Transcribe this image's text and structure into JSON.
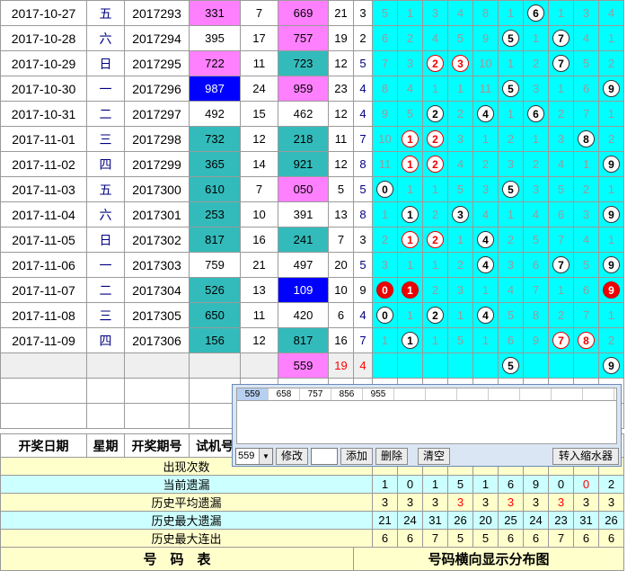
{
  "rows": [
    {
      "date": "2017-10-27",
      "week": "五",
      "period": "2017293",
      "test": "331",
      "test_class": "pink",
      "v1": "7",
      "draw": "669",
      "draw_class": "pink",
      "sum": "21",
      "span": "3",
      "span_class": "",
      "dist": [
        {
          "t": "n",
          "v": "5"
        },
        {
          "t": "n",
          "v": "1"
        },
        {
          "t": "n",
          "v": "3"
        },
        {
          "t": "n",
          "v": "4"
        },
        {
          "t": "n",
          "v": "8"
        },
        {
          "t": "n",
          "v": "1"
        },
        {
          "t": "w",
          "v": "6"
        },
        {
          "t": "n",
          "v": "1"
        },
        {
          "t": "n",
          "v": "3"
        },
        {
          "t": "n",
          "v": "4"
        }
      ]
    },
    {
      "date": "2017-10-28",
      "week": "六",
      "period": "2017294",
      "test": "395",
      "test_class": "",
      "v1": "17",
      "draw": "757",
      "draw_class": "pink",
      "sum": "19",
      "span": "2",
      "span_class": "",
      "dist": [
        {
          "t": "n",
          "v": "6"
        },
        {
          "t": "n",
          "v": "2"
        },
        {
          "t": "n",
          "v": "4"
        },
        {
          "t": "n",
          "v": "5"
        },
        {
          "t": "n",
          "v": "9"
        },
        {
          "t": "w",
          "v": "5"
        },
        {
          "t": "n",
          "v": "1"
        },
        {
          "t": "w",
          "v": "7"
        },
        {
          "t": "n",
          "v": "4"
        },
        {
          "t": "n",
          "v": "1"
        }
      ]
    },
    {
      "date": "2017-10-29",
      "week": "日",
      "period": "2017295",
      "test": "722",
      "test_class": "pink",
      "v1": "11",
      "draw": "723",
      "draw_class": "teal",
      "sum": "12",
      "span": "5",
      "span_class": "bl",
      "dist": [
        {
          "t": "n",
          "v": "7"
        },
        {
          "t": "n",
          "v": "3"
        },
        {
          "t": "r",
          "v": "2"
        },
        {
          "t": "r",
          "v": "3"
        },
        {
          "t": "n",
          "v": "10"
        },
        {
          "t": "n",
          "v": "1"
        },
        {
          "t": "n",
          "v": "2"
        },
        {
          "t": "w",
          "v": "7"
        },
        {
          "t": "n",
          "v": "5"
        },
        {
          "t": "n",
          "v": "2"
        }
      ]
    },
    {
      "date": "2017-10-30",
      "week": "一",
      "period": "2017296",
      "test": "987",
      "test_class": "blue",
      "v1": "24",
      "draw": "959",
      "draw_class": "pink",
      "sum": "23",
      "span": "4",
      "span_class": "bl",
      "dist": [
        {
          "t": "n",
          "v": "8"
        },
        {
          "t": "n",
          "v": "4"
        },
        {
          "t": "n",
          "v": "1"
        },
        {
          "t": "n",
          "v": "1"
        },
        {
          "t": "n",
          "v": "11"
        },
        {
          "t": "w",
          "v": "5"
        },
        {
          "t": "n",
          "v": "3"
        },
        {
          "t": "n",
          "v": "1"
        },
        {
          "t": "n",
          "v": "6"
        },
        {
          "t": "w",
          "v": "9"
        }
      ]
    },
    {
      "date": "2017-10-31",
      "week": "二",
      "period": "2017297",
      "test": "492",
      "test_class": "",
      "v1": "15",
      "draw": "462",
      "draw_class": "",
      "sum": "12",
      "span": "4",
      "span_class": "bl",
      "dist": [
        {
          "t": "n",
          "v": "9"
        },
        {
          "t": "n",
          "v": "5"
        },
        {
          "t": "w",
          "v": "2"
        },
        {
          "t": "n",
          "v": "2"
        },
        {
          "t": "w",
          "v": "4"
        },
        {
          "t": "n",
          "v": "1"
        },
        {
          "t": "w",
          "v": "6"
        },
        {
          "t": "n",
          "v": "2"
        },
        {
          "t": "n",
          "v": "7"
        },
        {
          "t": "n",
          "v": "1"
        }
      ]
    },
    {
      "date": "2017-11-01",
      "week": "三",
      "period": "2017298",
      "test": "732",
      "test_class": "teal",
      "v1": "12",
      "draw": "218",
      "draw_class": "teal",
      "sum": "11",
      "span": "7",
      "span_class": "bl",
      "dist": [
        {
          "t": "n",
          "v": "10"
        },
        {
          "t": "r",
          "v": "1"
        },
        {
          "t": "r",
          "v": "2"
        },
        {
          "t": "n",
          "v": "3"
        },
        {
          "t": "n",
          "v": "1"
        },
        {
          "t": "n",
          "v": "2"
        },
        {
          "t": "n",
          "v": "1"
        },
        {
          "t": "n",
          "v": "3"
        },
        {
          "t": "w",
          "v": "8"
        },
        {
          "t": "n",
          "v": "2"
        }
      ]
    },
    {
      "date": "2017-11-02",
      "week": "四",
      "period": "2017299",
      "test": "365",
      "test_class": "teal",
      "v1": "14",
      "draw": "921",
      "draw_class": "teal",
      "sum": "12",
      "span": "8",
      "span_class": "bl",
      "dist": [
        {
          "t": "n",
          "v": "11"
        },
        {
          "t": "r",
          "v": "1"
        },
        {
          "t": "r",
          "v": "2"
        },
        {
          "t": "n",
          "v": "4"
        },
        {
          "t": "n",
          "v": "2"
        },
        {
          "t": "n",
          "v": "3"
        },
        {
          "t": "n",
          "v": "2"
        },
        {
          "t": "n",
          "v": "4"
        },
        {
          "t": "n",
          "v": "1"
        },
        {
          "t": "w",
          "v": "9"
        }
      ]
    },
    {
      "date": "2017-11-03",
      "week": "五",
      "period": "2017300",
      "test": "610",
      "test_class": "teal",
      "v1": "7",
      "draw": "050",
      "draw_class": "pink",
      "sum": "5",
      "span": "5",
      "span_class": "bl",
      "dist": [
        {
          "t": "w",
          "v": "0"
        },
        {
          "t": "n",
          "v": "1"
        },
        {
          "t": "n",
          "v": "1"
        },
        {
          "t": "n",
          "v": "5"
        },
        {
          "t": "n",
          "v": "3"
        },
        {
          "t": "w",
          "v": "5"
        },
        {
          "t": "n",
          "v": "3"
        },
        {
          "t": "n",
          "v": "5"
        },
        {
          "t": "n",
          "v": "2"
        },
        {
          "t": "n",
          "v": "1"
        }
      ]
    },
    {
      "date": "2017-11-04",
      "week": "六",
      "period": "2017301",
      "test": "253",
      "test_class": "teal",
      "v1": "10",
      "draw": "391",
      "draw_class": "",
      "sum": "13",
      "span": "8",
      "span_class": "bl",
      "dist": [
        {
          "t": "n",
          "v": "1"
        },
        {
          "t": "w",
          "v": "1"
        },
        {
          "t": "n",
          "v": "2"
        },
        {
          "t": "w",
          "v": "3"
        },
        {
          "t": "n",
          "v": "4"
        },
        {
          "t": "n",
          "v": "1"
        },
        {
          "t": "n",
          "v": "4"
        },
        {
          "t": "n",
          "v": "6"
        },
        {
          "t": "n",
          "v": "3"
        },
        {
          "t": "w",
          "v": "9"
        }
      ]
    },
    {
      "date": "2017-11-05",
      "week": "日",
      "period": "2017302",
      "test": "817",
      "test_class": "teal",
      "v1": "16",
      "draw": "241",
      "draw_class": "teal",
      "sum": "7",
      "span": "3",
      "span_class": "",
      "dist": [
        {
          "t": "n",
          "v": "2"
        },
        {
          "t": "r",
          "v": "1"
        },
        {
          "t": "r",
          "v": "2"
        },
        {
          "t": "n",
          "v": "1"
        },
        {
          "t": "w",
          "v": "4"
        },
        {
          "t": "n",
          "v": "2"
        },
        {
          "t": "n",
          "v": "5"
        },
        {
          "t": "n",
          "v": "7"
        },
        {
          "t": "n",
          "v": "4"
        },
        {
          "t": "n",
          "v": "1"
        }
      ]
    },
    {
      "date": "2017-11-06",
      "week": "一",
      "period": "2017303",
      "test": "759",
      "test_class": "",
      "v1": "21",
      "draw": "497",
      "draw_class": "",
      "sum": "20",
      "span": "5",
      "span_class": "bl",
      "dist": [
        {
          "t": "n",
          "v": "3"
        },
        {
          "t": "n",
          "v": "1"
        },
        {
          "t": "n",
          "v": "1"
        },
        {
          "t": "n",
          "v": "2"
        },
        {
          "t": "w",
          "v": "4"
        },
        {
          "t": "n",
          "v": "3"
        },
        {
          "t": "n",
          "v": "6"
        },
        {
          "t": "w",
          "v": "7"
        },
        {
          "t": "n",
          "v": "5"
        },
        {
          "t": "w",
          "v": "9"
        }
      ]
    },
    {
      "date": "2017-11-07",
      "week": "二",
      "period": "2017304",
      "test": "526",
      "test_class": "teal",
      "v1": "13",
      "draw": "109",
      "draw_class": "blue",
      "sum": "10",
      "span": "9",
      "span_class": "",
      "dist": [
        {
          "t": "f",
          "v": "0"
        },
        {
          "t": "f",
          "v": "1"
        },
        {
          "t": "n",
          "v": "2"
        },
        {
          "t": "n",
          "v": "3"
        },
        {
          "t": "n",
          "v": "1"
        },
        {
          "t": "n",
          "v": "4"
        },
        {
          "t": "n",
          "v": "7"
        },
        {
          "t": "n",
          "v": "1"
        },
        {
          "t": "n",
          "v": "6"
        },
        {
          "t": "f",
          "v": "9"
        }
      ]
    },
    {
      "date": "2017-11-08",
      "week": "三",
      "period": "2017305",
      "test": "650",
      "test_class": "teal",
      "v1": "11",
      "draw": "420",
      "draw_class": "",
      "sum": "6",
      "span": "4",
      "span_class": "bl",
      "dist": [
        {
          "t": "w",
          "v": "0"
        },
        {
          "t": "n",
          "v": "1"
        },
        {
          "t": "w",
          "v": "2"
        },
        {
          "t": "n",
          "v": "1"
        },
        {
          "t": "w",
          "v": "4"
        },
        {
          "t": "n",
          "v": "5"
        },
        {
          "t": "n",
          "v": "8"
        },
        {
          "t": "n",
          "v": "2"
        },
        {
          "t": "n",
          "v": "7"
        },
        {
          "t": "n",
          "v": "1"
        }
      ]
    },
    {
      "date": "2017-11-09",
      "week": "四",
      "period": "2017306",
      "test": "156",
      "test_class": "teal",
      "v1": "12",
      "draw": "817",
      "draw_class": "teal",
      "sum": "16",
      "span": "7",
      "span_class": "bl",
      "dist": [
        {
          "t": "n",
          "v": "1"
        },
        {
          "t": "w",
          "v": "1"
        },
        {
          "t": "n",
          "v": "1"
        },
        {
          "t": "n",
          "v": "5"
        },
        {
          "t": "n",
          "v": "1"
        },
        {
          "t": "n",
          "v": "6"
        },
        {
          "t": "n",
          "v": "9"
        },
        {
          "t": "r",
          "v": "7"
        },
        {
          "t": "r",
          "v": "8"
        },
        {
          "t": "n",
          "v": "2"
        }
      ]
    }
  ],
  "pending": {
    "draw": "559",
    "sum": "19",
    "span": "4",
    "dist": [
      {
        "t": "e",
        "v": ""
      },
      {
        "t": "e",
        "v": ""
      },
      {
        "t": "e",
        "v": ""
      },
      {
        "t": "e",
        "v": ""
      },
      {
        "t": "e",
        "v": ""
      },
      {
        "t": "w",
        "v": "5"
      },
      {
        "t": "e",
        "v": ""
      },
      {
        "t": "e",
        "v": ""
      },
      {
        "t": "e",
        "v": ""
      },
      {
        "t": "w",
        "v": "9"
      }
    ]
  },
  "header": {
    "date": "开奖日期",
    "week": "星期",
    "period": "开奖期号",
    "test": "试机号"
  },
  "stats": [
    {
      "label": "出现次数",
      "class": "y",
      "values": [
        "",
        "",
        "",
        "",
        "",
        "",
        "",
        "",
        "",
        ""
      ]
    },
    {
      "label": "当前遗漏",
      "class": "c",
      "values": [
        "1",
        "0",
        "1",
        "5",
        "1",
        "6",
        "9",
        "0",
        "0",
        "2"
      ],
      "red": [
        8
      ]
    },
    {
      "label": "历史平均遗漏",
      "class": "y",
      "values": [
        "3",
        "3",
        "3",
        "3",
        "3",
        "3",
        "3",
        "3",
        "3",
        "3"
      ],
      "red": [
        3,
        5,
        7
      ]
    },
    {
      "label": "历史最大遗漏",
      "class": "c",
      "values": [
        "21",
        "24",
        "31",
        "26",
        "20",
        "25",
        "24",
        "23",
        "31",
        "26"
      ]
    },
    {
      "label": "历史最大连出",
      "class": "y",
      "values": [
        "6",
        "6",
        "7",
        "5",
        "5",
        "6",
        "6",
        "7",
        "6",
        "6"
      ]
    }
  ],
  "footer": {
    "left": "号　码　表",
    "right": "号码横向显示分布图"
  },
  "panel": {
    "history": [
      "559",
      "658",
      "757",
      "856",
      "955"
    ],
    "select_value": "559",
    "modify": "修改",
    "add": "添加",
    "delete": "删除",
    "clear": "清空",
    "transfer": "转入缩水器"
  }
}
